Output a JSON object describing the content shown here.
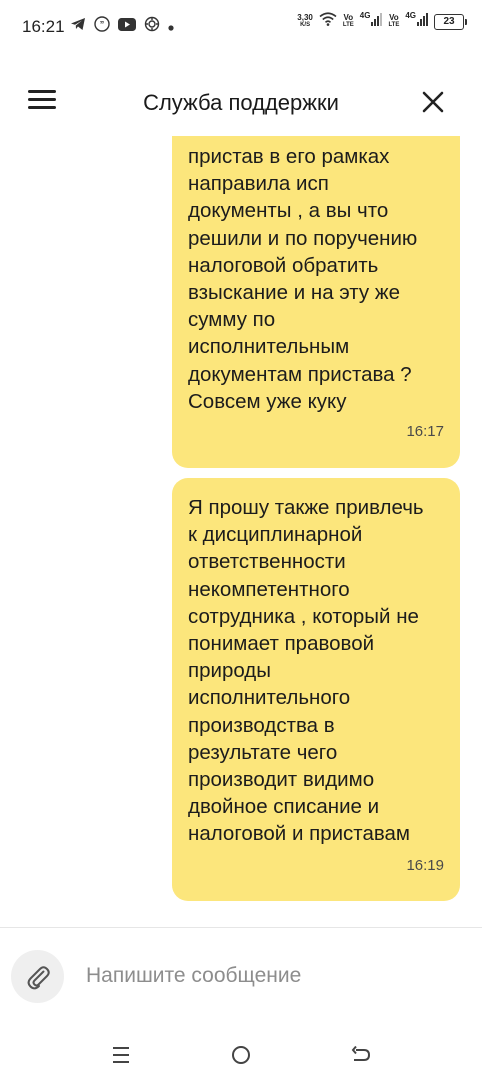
{
  "status_bar": {
    "time": "16:21",
    "left_icons": [
      "telegram-icon",
      "quote-icon",
      "youtube-icon",
      "app-icon",
      "dot-icon"
    ],
    "speed_value": "3,30",
    "speed_unit": "K/S",
    "sim1_label_top": "Vo",
    "sim1_label_bottom": "LTE",
    "sim1_gen": "4G",
    "sim2_label_top": "Vo",
    "sim2_label_bottom": "LTE",
    "sim2_gen": "4G",
    "battery": "23"
  },
  "header": {
    "title": "Служба поддержки",
    "menu_icon": "hamburger-icon",
    "close_icon": "close-icon"
  },
  "messages": [
    {
      "text": "пристав в его рамках\nнаправила исп\nдокументы , а вы что\nрешили и по поручению\nналоговой обратить\nвзыскание и на эту же\nсумму по\nисполнительным\nдокументам пристава ?\nСовсем уже куку",
      "time": "16:17"
    },
    {
      "text": "Я прошу также привлечь\nк дисциплинарной\nответственности\nнекомпетентного\nсотрудника , который не\nпонимает правовой\nприроды\nисполнительного\nпроизводства в\nрезультате чего\nпроизводит видимо\nдвойное списание и\nналоговой и приставам",
      "time": "16:19"
    }
  ],
  "composer": {
    "placeholder": "Напишите сообщение",
    "value": "",
    "attach_icon": "paperclip-icon"
  },
  "navbar": {
    "items": [
      "menu-icon",
      "home-icon",
      "back-icon"
    ]
  },
  "colors": {
    "bubble": "#fce67c",
    "background": "#ffffff",
    "text": "#1c1c1c"
  }
}
